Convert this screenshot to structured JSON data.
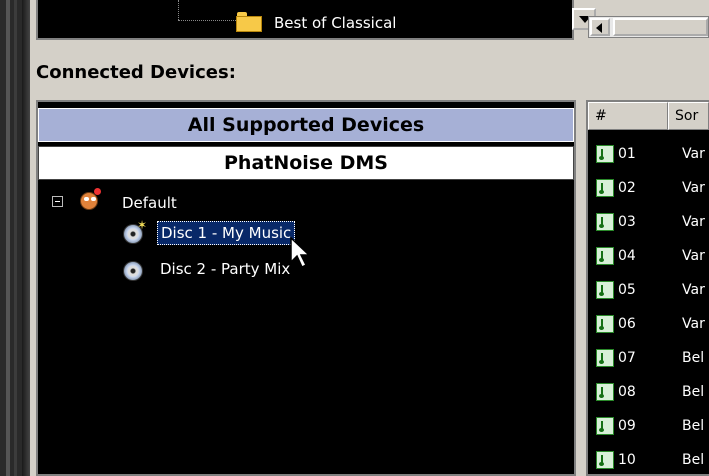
{
  "playlist_tree": {
    "item_label": "Best of Classical"
  },
  "devices": {
    "heading": "Connected Devices:",
    "tab_all": "All Supported Devices",
    "tab_phatnoise": "PhatNoise DMS",
    "tree": {
      "root_label": "Default",
      "discs": [
        {
          "label": "Disc 1 - My Music",
          "selected": true
        },
        {
          "label": "Disc 2 - Party Mix",
          "selected": false
        }
      ]
    }
  },
  "tracks": {
    "columns": [
      "#",
      "Sor"
    ],
    "rows": [
      {
        "num": "01",
        "song": "Var"
      },
      {
        "num": "02",
        "song": "Var"
      },
      {
        "num": "03",
        "song": "Var"
      },
      {
        "num": "04",
        "song": "Var"
      },
      {
        "num": "05",
        "song": "Var"
      },
      {
        "num": "06",
        "song": "Var"
      },
      {
        "num": "07",
        "song": "Bel"
      },
      {
        "num": "08",
        "song": "Bel"
      },
      {
        "num": "09",
        "song": "Bel"
      },
      {
        "num": "10",
        "song": "Bel"
      }
    ]
  },
  "icons": {
    "folder": "folder-icon",
    "dropdown": "chevron-down-icon",
    "scroll_left": "arrow-left-icon",
    "collapse": "minus-box-icon",
    "device_root": "default-profile-icon",
    "disc": "disc-icon",
    "track": "music-note-icon",
    "cursor": "mouse-pointer-icon"
  },
  "colors": {
    "selection_bg": "#082868",
    "tab_all_bg": "#a6b0d6",
    "panel_bg": "#000000",
    "chrome_bg": "#d4d0c8"
  }
}
